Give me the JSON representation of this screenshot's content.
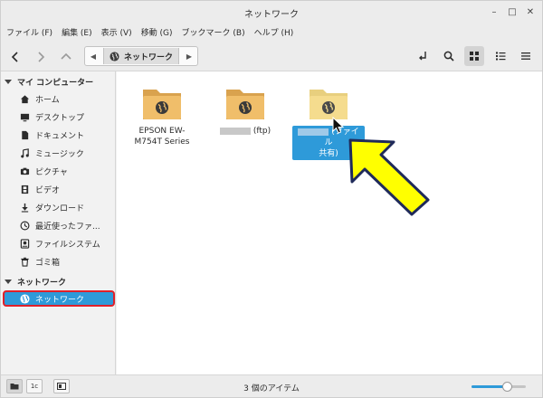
{
  "window": {
    "title": "ネットワーク",
    "controls": {
      "minimize": "–",
      "maximize": "□",
      "close": "✕"
    }
  },
  "menu": [
    "ファイル (F)",
    "編集 (E)",
    "表示 (V)",
    "移動 (G)",
    "ブックマーク (B)",
    "ヘルプ (H)"
  ],
  "path": {
    "current": "ネットワーク"
  },
  "sidebar": {
    "sections": [
      {
        "title": "マイ コンピューター",
        "items": [
          {
            "label": "ホーム",
            "icon": "home-icon"
          },
          {
            "label": "デスクトップ",
            "icon": "desktop-icon"
          },
          {
            "label": "ドキュメント",
            "icon": "document-icon"
          },
          {
            "label": "ミュージック",
            "icon": "music-icon"
          },
          {
            "label": "ピクチャ",
            "icon": "camera-icon"
          },
          {
            "label": "ビデオ",
            "icon": "video-icon"
          },
          {
            "label": "ダウンロード",
            "icon": "download-icon"
          },
          {
            "label": "最近使ったファ...",
            "icon": "recent-icon"
          },
          {
            "label": "ファイルシステム",
            "icon": "drive-icon"
          },
          {
            "label": "ゴミ箱",
            "icon": "trash-icon"
          }
        ]
      },
      {
        "title": "ネットワーク",
        "items": [
          {
            "label": "ネットワーク",
            "icon": "network-icon"
          }
        ]
      }
    ]
  },
  "files": [
    {
      "line1": "EPSON EW-",
      "line2": "M754T Series"
    },
    {
      "suffix": "(ftp)"
    },
    {
      "suffix": "(ファイル",
      "line2": "共有)"
    }
  ],
  "status": {
    "text": "3 個のアイテム",
    "zoom_level": 0.65
  },
  "statusbar_buttons": [
    "1c"
  ],
  "colors": {
    "accent": "#2e9ad9",
    "highlight_border": "#e0202a",
    "folder": "#f0be6a",
    "arrow": "#ffff00"
  }
}
